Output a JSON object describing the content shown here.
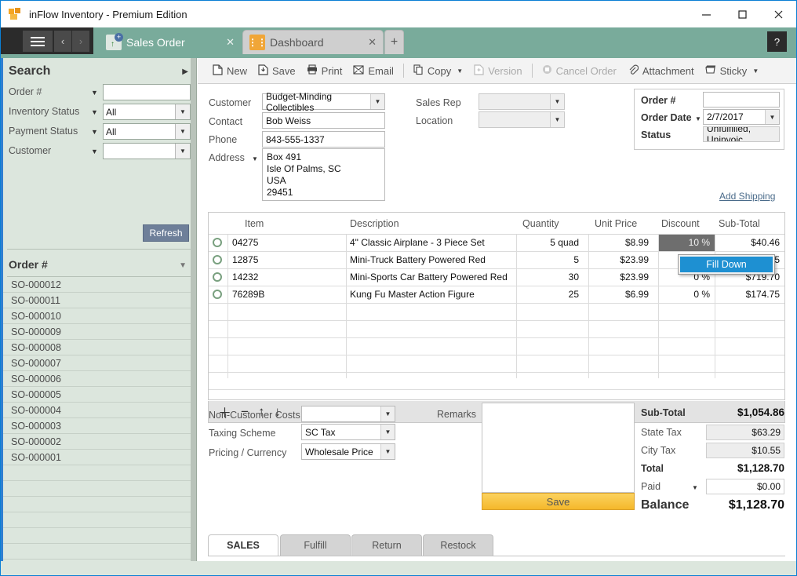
{
  "window": {
    "title": "inFlow Inventory - Premium Edition",
    "icon": "inflow-logo-icon",
    "minimize": "—",
    "maximize": "□",
    "close": "✕"
  },
  "tabbar": {
    "menu_icon": "hamburger-icon",
    "back": "‹",
    "forward": "›",
    "new_tab": "+",
    "help": "?",
    "tabs": [
      {
        "label": "Sales Order",
        "icon": "sales-order-icon",
        "close": "✕",
        "active": true
      },
      {
        "label": "Dashboard",
        "icon": "dashboard-icon",
        "close": "✕",
        "active": false
      }
    ]
  },
  "toolbar": {
    "items": [
      {
        "label": "New",
        "icon": "new-document-icon",
        "dim": false,
        "caret": false
      },
      {
        "label": "Save",
        "icon": "save-icon",
        "dim": false,
        "caret": false
      },
      {
        "label": "Print",
        "icon": "printer-icon",
        "dim": false,
        "caret": false
      },
      {
        "label": "Email",
        "icon": "envelope-icon",
        "dim": false,
        "caret": false
      },
      {
        "label": "Copy",
        "icon": "copy-icon",
        "dim": false,
        "caret": true
      },
      {
        "label": "Version",
        "icon": "version-icon",
        "dim": true,
        "caret": false
      },
      {
        "label": "Cancel Order",
        "icon": "cancel-circle-icon",
        "dim": true,
        "caret": false
      },
      {
        "label": "Attachment",
        "icon": "paperclip-icon",
        "dim": false,
        "caret": false
      },
      {
        "label": "Sticky",
        "icon": "sticky-note-icon",
        "dim": false,
        "caret": true
      }
    ]
  },
  "search": {
    "title": "Search",
    "expand_icon": "expand-arrow-icon",
    "fields": [
      {
        "label": "Order #",
        "value": "",
        "type": "text"
      },
      {
        "label": "Inventory Status",
        "value": "All",
        "type": "select"
      },
      {
        "label": "Payment Status",
        "value": "All",
        "type": "select"
      },
      {
        "label": "Customer",
        "value": "",
        "type": "select"
      }
    ],
    "refresh_label": "Refresh",
    "list_header": "Order #",
    "orders": [
      "SO-000012",
      "SO-000011",
      "SO-000010",
      "SO-000009",
      "SO-000008",
      "SO-000007",
      "SO-000006",
      "SO-000005",
      "SO-000004",
      "SO-000003",
      "SO-000002",
      "SO-000001"
    ]
  },
  "header_form": {
    "customer_label": "Customer",
    "customer_value": "Budget-Minding Collectibles",
    "contact_label": "Contact",
    "contact_value": "Bob Weiss",
    "phone_label": "Phone",
    "phone_value": "843-555-1337",
    "address_label": "Address",
    "address_value": "Box 491\nIsle Of Palms, SC\nUSA\n29451",
    "sales_rep_label": "Sales Rep",
    "sales_rep_value": "",
    "location_label": "Location",
    "location_value": "",
    "order_num_label": "Order #",
    "order_num_value": "",
    "order_date_label": "Order Date",
    "order_date_value": "2/7/2017",
    "status_label": "Status",
    "status_value": "Unfulfilled, Uninvoic",
    "add_shipping": "Add Shipping"
  },
  "grid": {
    "columns": [
      "Item",
      "Description",
      "Quantity",
      "Unit Price",
      "Discount",
      "Sub-Total"
    ],
    "rows": [
      {
        "item": "04275",
        "description": "4\" Classic Airplane - 3 Piece Set",
        "quantity": "5 quad",
        "unit_price": "$8.99",
        "discount": "10 %",
        "subtotal": "$40.46",
        "selected_discount": true
      },
      {
        "item": "12875",
        "description": "Mini-Truck Battery Powered Red",
        "quantity": "5",
        "unit_price": "$23.99",
        "discount": "",
        "subtotal": "5",
        "selected_discount": false
      },
      {
        "item": "14232",
        "description": "Mini-Sports Car Battery Powered Red",
        "quantity": "30",
        "unit_price": "$23.99",
        "discount": "0 %",
        "subtotal": "$719.70",
        "selected_discount": false
      },
      {
        "item": "76289B",
        "description": "Kung Fu Master Action Figure",
        "quantity": "25",
        "unit_price": "$6.99",
        "discount": "0 %",
        "subtotal": "$174.75",
        "selected_discount": false
      }
    ],
    "empty_rows": 5,
    "toolbar_icons": [
      "add-row-icon",
      "remove-row-icon",
      "move-up-icon",
      "move-down-icon"
    ],
    "toolbar_glyphs": [
      "＋",
      "−",
      "↑",
      "↓"
    ]
  },
  "context_menu": {
    "items": [
      "Fill Down"
    ]
  },
  "bottom_form": {
    "non_customer_costs_label": "Non-Customer Costs",
    "non_customer_costs_value": "",
    "taxing_scheme_label": "Taxing Scheme",
    "taxing_scheme_value": "SC Tax",
    "pricing_currency_label": "Pricing / Currency",
    "pricing_currency_value": "Wholesale Price",
    "remarks_label": "Remarks",
    "remarks_value": "",
    "save_label": "Save"
  },
  "totals": {
    "subtotal_label": "Sub-Total",
    "subtotal_value": "$1,054.86",
    "state_tax_label": "State Tax",
    "state_tax_value": "$63.29",
    "city_tax_label": "City Tax",
    "city_tax_value": "$10.55",
    "total_label": "Total",
    "total_value": "$1,128.70",
    "paid_label": "Paid",
    "paid_value": "$0.00",
    "balance_label": "Balance",
    "balance_value": "$1,128.70"
  },
  "bottom_tabs": [
    {
      "label": "SALES",
      "active": true
    },
    {
      "label": "Fulfill",
      "active": false
    },
    {
      "label": "Return",
      "active": false
    },
    {
      "label": "Restock",
      "active": false
    }
  ],
  "colors": {
    "accent_green": "#79ab9b",
    "panel_green": "#dce6dd",
    "save_yellow": "#f5b82b",
    "menu_blue": "#1e90d2",
    "window_border": "#0a7fd4"
  }
}
